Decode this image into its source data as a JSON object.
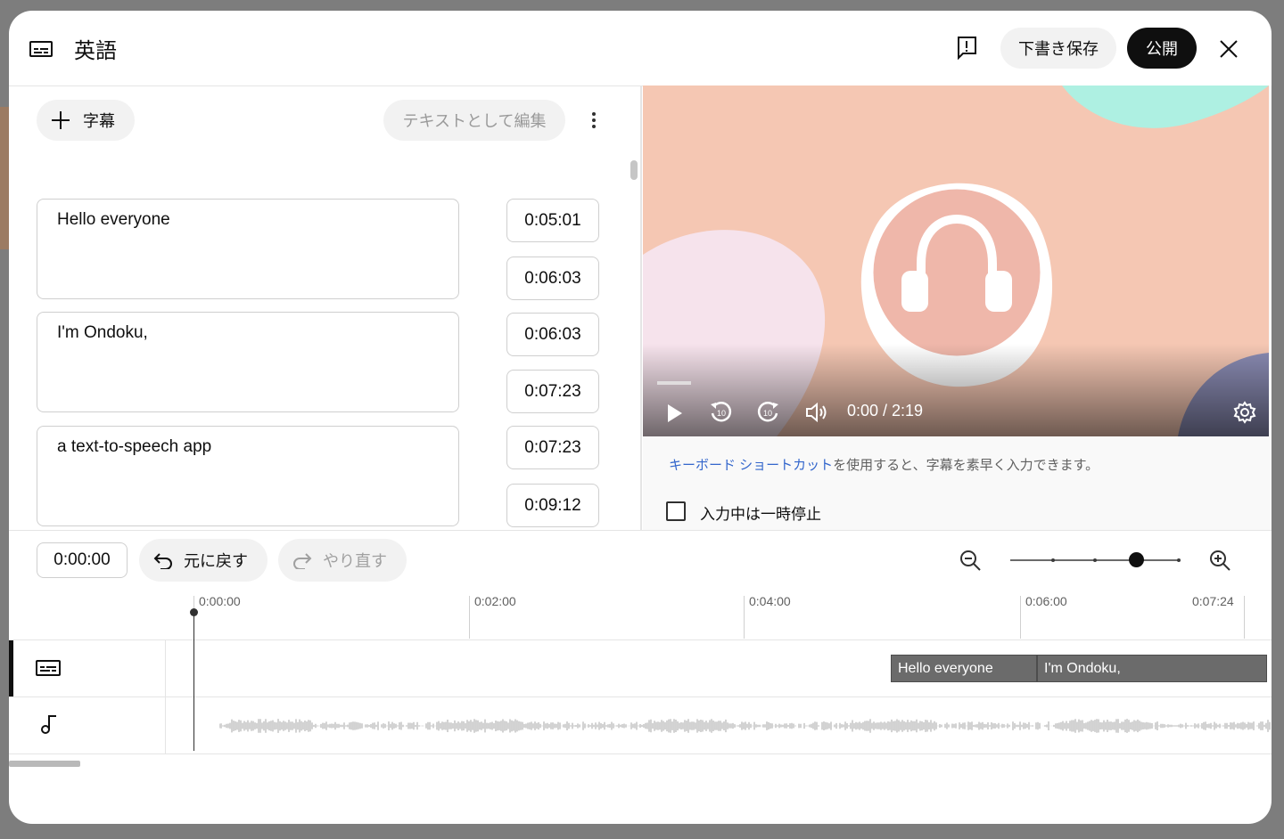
{
  "header": {
    "title": "英語",
    "save_draft_label": "下書き保存",
    "publish_label": "公開"
  },
  "editor": {
    "add_caption_label": "字幕",
    "edit_as_text_label": "テキストとして編集",
    "captions": [
      {
        "text": "Hello everyone",
        "start": "0:05:01",
        "end": "0:06:03"
      },
      {
        "text": "I'm Ondoku,",
        "start": "0:06:03",
        "end": "0:07:23"
      },
      {
        "text": "a text-to-speech app",
        "start": "0:07:23",
        "end": "0:09:12"
      }
    ]
  },
  "preview": {
    "timecode": "0:00 / 2:19",
    "shortcut_link": "キーボード ショートカット",
    "shortcut_rest": "を使用すると、字幕を素早く入力できます。",
    "pause_while_typing_label": "入力中は一時停止",
    "pause_while_typing_checked": false
  },
  "toolbar": {
    "current_time": "0:00:00",
    "undo_label": "元に戻す",
    "redo_label": "やり直す",
    "zoom_level_fraction": 0.75
  },
  "timeline": {
    "ticks": [
      "0:00:00",
      "0:02:00",
      "0:04:00",
      "0:06:00",
      "0:07:24"
    ],
    "blocks": [
      "Hello everyone",
      "I'm Ondoku,"
    ]
  },
  "colors": {
    "publish_bg": "#0f0f0f",
    "video_bg": "#f5c7b3",
    "link": "#3366cc",
    "caption_block": "#6b6b6b"
  },
  "icons": [
    "subtitles-icon",
    "report-icon",
    "close-icon",
    "plus-icon",
    "more-vert-icon",
    "play-icon",
    "rewind-10-icon",
    "forward-10-icon",
    "volume-icon",
    "settings-icon",
    "undo-icon",
    "redo-icon",
    "zoom-out-icon",
    "zoom-in-icon",
    "music-note-icon",
    "headphones-icon"
  ]
}
